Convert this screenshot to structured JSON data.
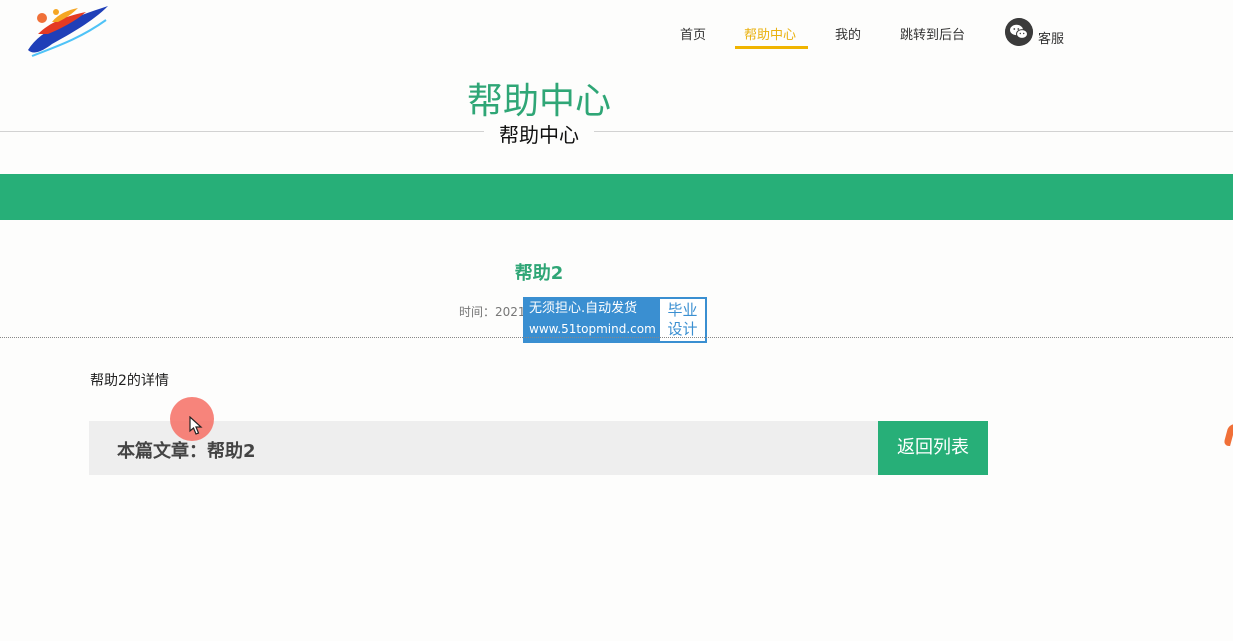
{
  "nav": {
    "items": [
      {
        "label": "首页"
      },
      {
        "label": "帮助中心"
      },
      {
        "label": "我的"
      },
      {
        "label": "跳转到后台"
      }
    ],
    "service_label": "客服",
    "active_color": "#e9b10f"
  },
  "header": {
    "title": "帮助中心",
    "subtitle": "帮助中心"
  },
  "article": {
    "title": "帮助2",
    "time_label": "时间：2021",
    "content": "帮助2的详情",
    "current_label": "本篇文章：帮助2",
    "back_button": "返回列表"
  },
  "watermark": {
    "line1": "无须担心.自动发货",
    "line2": "www.51topmind.com",
    "right_line1": "毕业",
    "right_line2": "设计"
  },
  "colors": {
    "brand_green": "#27af78",
    "title_green": "#2fa676",
    "accent_yellow": "#f0b400"
  }
}
